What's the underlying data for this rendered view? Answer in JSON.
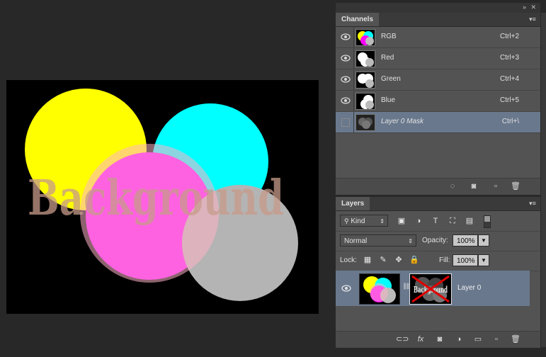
{
  "channels_panel": {
    "tab": "Channels",
    "rows": [
      {
        "name": "RGB",
        "shortcut": "Ctrl+2",
        "eye": true
      },
      {
        "name": "Red",
        "shortcut": "Ctrl+3",
        "eye": true
      },
      {
        "name": "Green",
        "shortcut": "Ctrl+4",
        "eye": true
      },
      {
        "name": "Blue",
        "shortcut": "Ctrl+5",
        "eye": true
      },
      {
        "name": "Layer 0 Mask",
        "shortcut": "Ctrl+\\",
        "eye": false
      }
    ]
  },
  "layers_panel": {
    "tab": "Layers",
    "filter_kind": "Kind",
    "blend_mode": "Normal",
    "opacity_label": "Opacity:",
    "opacity_value": "100%",
    "lock_label": "Lock:",
    "fill_label": "Fill:",
    "fill_value": "100%",
    "layer": {
      "name": "Layer 0",
      "mask_text": "Background"
    }
  },
  "canvas": {
    "text": "Background",
    "colors": {
      "yellow": "#ffff00",
      "cyan": "#00ffff",
      "magenta": "#ff00ff",
      "gray": "#b4b4b4",
      "pink": "#ffb3c6",
      "background": "#000000"
    }
  },
  "icons": {
    "collapse": "double-chevron-right-icon",
    "eye": "eye-icon",
    "panel_menu": "panel-menu-icon"
  }
}
